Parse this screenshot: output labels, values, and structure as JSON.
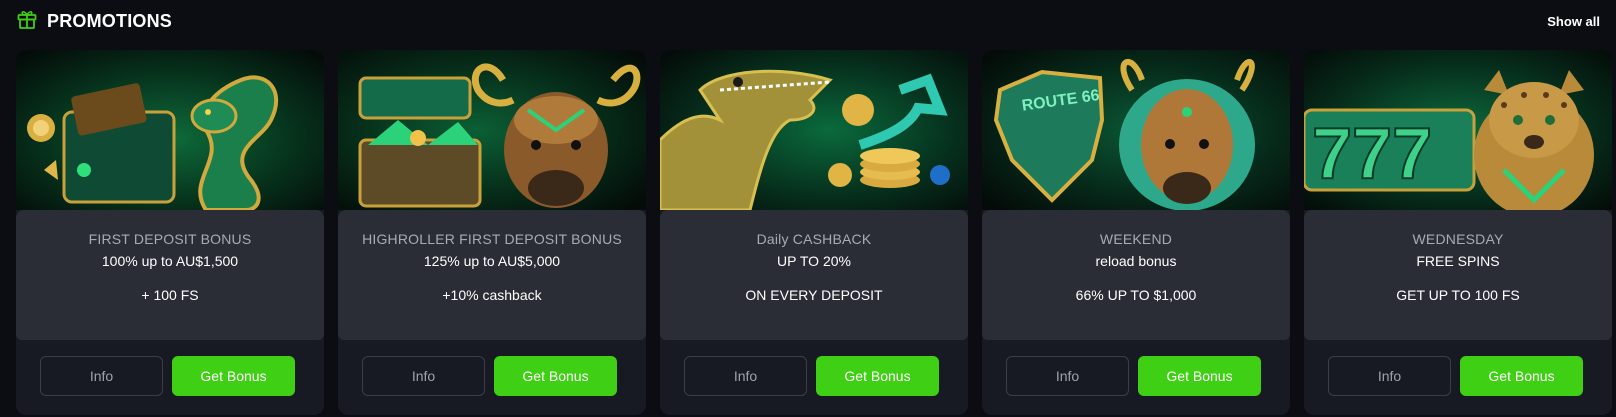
{
  "header": {
    "title": "PROMOTIONS",
    "show_all": "Show all",
    "icon": "gift-icon",
    "accent_color": "#3fcf14"
  },
  "promotions": [
    {
      "line1": "FIRST DEPOSIT BONUS",
      "line2": "100% up to AU$1,500",
      "line3": "+ 100 FS",
      "info_label": "Info",
      "bonus_label": "Get Bonus",
      "art": "snake-wallet-artwork"
    },
    {
      "line1": "HIGHROLLER FIRST DEPOSIT BONUS",
      "line2": "125% up to AU$5,000",
      "line3": "+10% cashback",
      "info_label": "Info",
      "bonus_label": "Get Bonus",
      "art": "bull-treasure-chest-artwork"
    },
    {
      "line1": "Daily CASHBACK",
      "line2": "UP TO 20%",
      "line3": "ON EVERY DEPOSIT",
      "info_label": "Info",
      "bonus_label": "Get Bonus",
      "art": "crocodile-coins-artwork"
    },
    {
      "line1": "WEEKEND",
      "line2": "reload bonus",
      "line3": "66% UP TO $1,000",
      "info_label": "Info",
      "bonus_label": "Get Bonus",
      "art": "bison-route-66-artwork",
      "art_text": "ROUTE 66"
    },
    {
      "line1": "WEDNESDAY",
      "line2": "FREE SPINS",
      "line3": "GET UP TO 100 FS",
      "info_label": "Info",
      "bonus_label": "Get Bonus",
      "art": "leopard-777-artwork",
      "art_text": "777"
    }
  ]
}
